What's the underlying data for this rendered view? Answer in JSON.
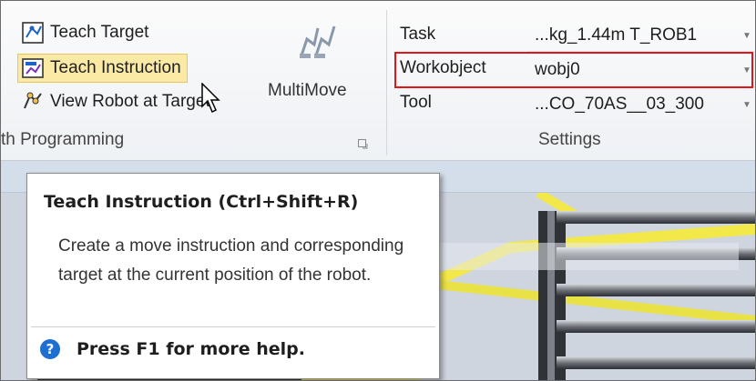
{
  "ribbon": {
    "path_programming": {
      "buttons": [
        {
          "label": "Teach Target",
          "icon": "teach-target-icon"
        },
        {
          "label": "Teach Instruction",
          "icon": "teach-instruction-icon",
          "state": "hover"
        },
        {
          "label": "View Robot at Target",
          "icon": "view-robot-icon"
        }
      ],
      "group_label": "th Programming",
      "multimove_label": "MultiMove"
    },
    "settings": {
      "task_label": "Task",
      "task_value": "...kg_1.44m T_ROB1",
      "workobject_label": "Workobject",
      "workobject_value": "wobj0",
      "tool_label": "Tool",
      "tool_value": "...CO_70AS__03_300",
      "group_label": "Settings"
    }
  },
  "tooltip": {
    "title": "Teach Instruction (Ctrl+Shift+R)",
    "body": "Create a move instruction and corresponding target at the current position of the robot.",
    "help": "Press F1 for more help."
  },
  "colors": {
    "highlight_border": "#e2151a",
    "hover_fill": "#fbeaa6",
    "help_icon": "#1f6fd1"
  }
}
